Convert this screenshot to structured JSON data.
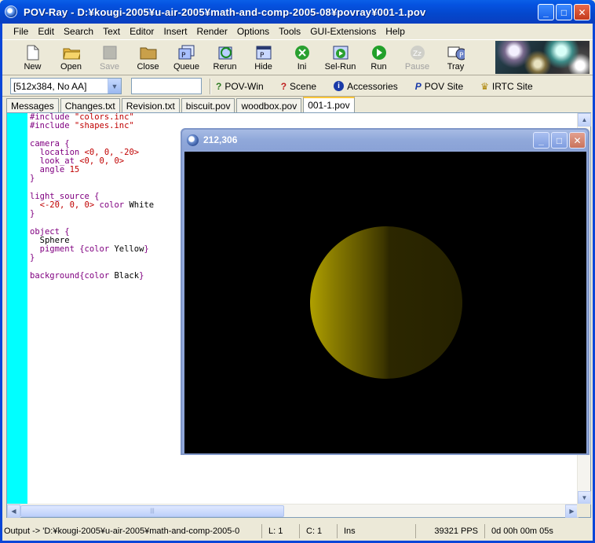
{
  "window": {
    "title": "POV-Ray - D:¥kougi-2005¥u-air-2005¥math-and-comp-2005-08¥povray¥001-1.pov",
    "minimize": "_",
    "maximize": "□",
    "close": "✕"
  },
  "menu": [
    "File",
    "Edit",
    "Search",
    "Text",
    "Editor",
    "Insert",
    "Render",
    "Options",
    "Tools",
    "GUI-Extensions",
    "Help"
  ],
  "toolbar": {
    "new": "New",
    "open": "Open",
    "save": "Save",
    "close": "Close",
    "queue": "Queue",
    "rerun": "Rerun",
    "hide": "Hide",
    "ini": "Ini",
    "selrun": "Sel-Run",
    "run": "Run",
    "pause": "Pause",
    "tray": "Tray"
  },
  "toolbar2": {
    "resolution": "[512x384, No AA]",
    "command_value": "",
    "povwin": "POV-Win",
    "scene": "Scene",
    "accessories": "Accessories",
    "povsite": "POV Site",
    "irtc": "IRTC Site"
  },
  "tabs": [
    "Messages",
    "Changes.txt",
    "Revision.txt",
    "biscuit.pov",
    "woodbox.pov",
    "001-1.pov"
  ],
  "active_tab_index": 5,
  "code": {
    "l1a": "#include ",
    "l1b": "\"colors.inc\"",
    "l2a": "#include ",
    "l2b": "\"shapes.inc\"",
    "l4": "camera {",
    "l5a": "  location ",
    "l5b": "<0, 0, -20>",
    "l6a": "  look_at ",
    "l6b": "<0, 0, 0>",
    "l7a": "  angle ",
    "l7b": "15",
    "l8": "}",
    "l10": "light_source {",
    "l11a": "  ",
    "l11b": "<-20, 0, 0>",
    "l11c": " color ",
    "l11d": "White",
    "l12": "}",
    "l14": "object {",
    "l15": "  Sphere",
    "l16a": "  pigment {color ",
    "l16b": "Yellow",
    "l16c": "}",
    "l17": "}",
    "l19a": "background{color ",
    "l19b": "Black",
    "l19c": "}"
  },
  "render_window": {
    "title": "212,306"
  },
  "status": {
    "output": "Output -> 'D:¥kougi-2005¥u-air-2005¥math-and-comp-2005-0",
    "line": "L: 1",
    "col": "C: 1",
    "mode": "Ins",
    "pps": "39321 PPS",
    "time": "0d 00h 00m 05s"
  },
  "colors": {
    "titlebar": "#0553e0",
    "gutter": "#00ffff",
    "sphere": "#b0a000"
  }
}
